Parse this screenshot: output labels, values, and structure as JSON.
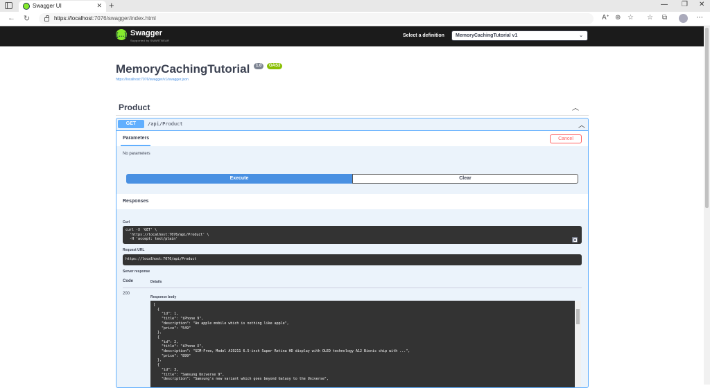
{
  "browser": {
    "tab_title": "Swagger UI",
    "url_host": "https://localhost",
    "url_rest": ":7076/swagger/index.html"
  },
  "topbar": {
    "logo_text": "Swagger",
    "logo_sub": "Supported by SMARTBEAR",
    "def_label": "Select a definition",
    "def_value": "MemoryCachingTutorial v1"
  },
  "info": {
    "title": "MemoryCachingTutorial",
    "version": "1.0",
    "oas": "OAS3",
    "link": "https://localhost:7076/swagger/v1/swagger.json"
  },
  "tag": {
    "name": "Product"
  },
  "operation": {
    "method": "GET",
    "path": "/api/Product",
    "params_tab": "Parameters",
    "cancel_label": "Cancel",
    "no_params": "No parameters",
    "execute_label": "Execute",
    "clear_label": "Clear",
    "responses_title": "Responses",
    "curl_label": "Curl",
    "curl_text": "curl -X 'GET' \\\n  'https://localhost:7076/api/Product' \\\n  -H 'accept: text/plain'",
    "request_url_label": "Request URL",
    "request_url": "https://localhost:7076/api/Product",
    "server_response_label": "Server response",
    "code_header": "Code",
    "details_header": "Details",
    "status_code": "200",
    "response_body_label": "Response body",
    "response_body": "[\n  {\n    \"id\": 1,\n    \"title\": \"iPhone 9\",\n    \"description\": \"An apple mobile which is nothing like apple\",\n    \"price\": \"549\"\n  },\n  {\n    \"id\": 2,\n    \"title\": \"iPhone X\",\n    \"description\": \"SIM-Free, Model A19211 6.5-inch Super Retina HD display with OLED technology A12 Bionic chip with ...\",\n    \"price\": \"899\"\n  },\n  {\n    \"id\": 3,\n    \"title\": \"Samsung Universe 9\",\n    \"description\": \"Samsung's new variant which goes beyond Galaxy to the Universe\","
  }
}
